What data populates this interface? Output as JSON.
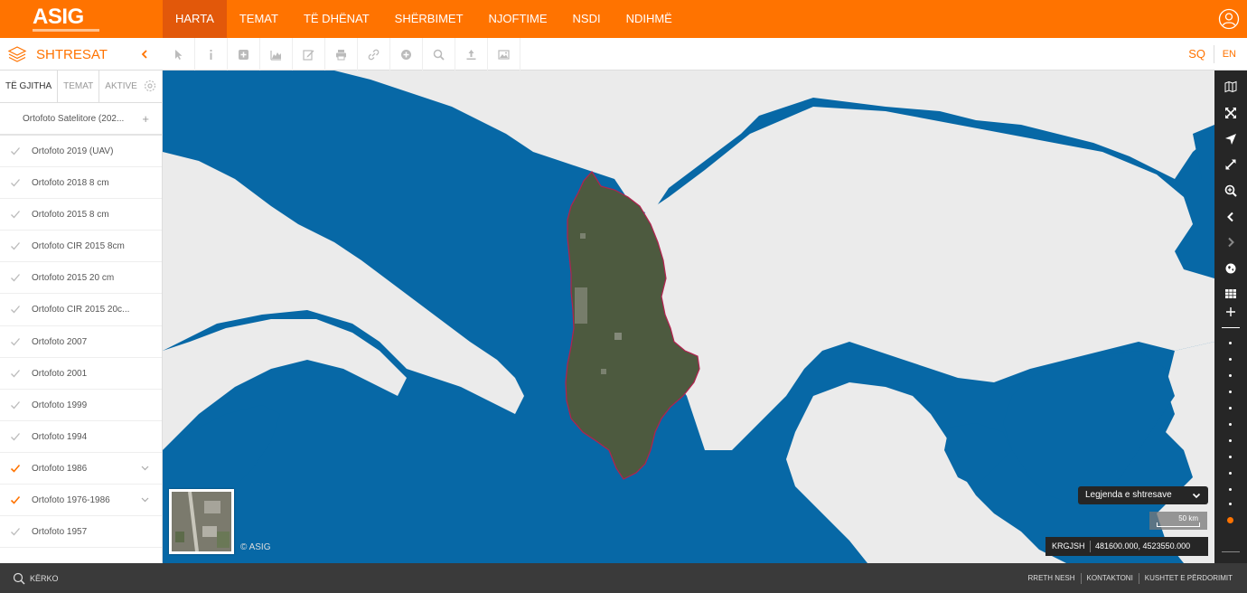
{
  "header": {
    "logo_text": "ASIG",
    "nav": [
      {
        "label": "HARTA",
        "active": true
      },
      {
        "label": "TEMAT",
        "active": false
      },
      {
        "label": "TË DHËNAT",
        "active": false
      },
      {
        "label": "SHËRBIMET",
        "active": false
      },
      {
        "label": "NJOFTIME",
        "active": false
      },
      {
        "label": "NSDI",
        "active": false
      },
      {
        "label": "NDIHMË",
        "active": false
      }
    ],
    "user_icon": "user-circle-icon"
  },
  "toolbar": {
    "layers_title": "SHTRESAT",
    "collapse_icon": "chevron-left-icon",
    "tools": [
      "pointer-icon",
      "info-icon",
      "add-box-icon",
      "chart-icon",
      "edit-icon",
      "print-icon",
      "link-icon",
      "plus-circle-icon",
      "search-icon",
      "upload-icon",
      "image-icon"
    ],
    "lang_sq": "SQ",
    "lang_en": "EN"
  },
  "sidebar": {
    "tabs": [
      "TË GJITHA",
      "TEMAT",
      "AKTIVE"
    ],
    "group": "Ortofoto Satelitore (202...",
    "layers": [
      {
        "label": "Ortofoto 2019 (UAV)",
        "checked": false,
        "expandable": false
      },
      {
        "label": "Ortofoto 2018 8 cm",
        "checked": false,
        "expandable": false
      },
      {
        "label": "Ortofoto 2015 8 cm",
        "checked": false,
        "expandable": false
      },
      {
        "label": "Ortofoto CIR 2015 8cm",
        "checked": false,
        "expandable": false
      },
      {
        "label": "Ortofoto 2015 20 cm",
        "checked": false,
        "expandable": false
      },
      {
        "label": "Ortofoto CIR 2015 20c...",
        "checked": false,
        "expandable": false
      },
      {
        "label": "Ortofoto 2007",
        "checked": false,
        "expandable": false
      },
      {
        "label": "Ortofoto 2001",
        "checked": false,
        "expandable": false
      },
      {
        "label": "Ortofoto 1999",
        "checked": false,
        "expandable": false
      },
      {
        "label": "Ortofoto 1994",
        "checked": false,
        "expandable": false
      },
      {
        "label": "Ortofoto 1986",
        "checked": true,
        "expandable": true
      },
      {
        "label": "Ortofoto 1976-1986",
        "checked": true,
        "expandable": true
      },
      {
        "label": "Ortofoto 1957",
        "checked": false,
        "expandable": false
      }
    ]
  },
  "map": {
    "copyright": "© ASIG",
    "legend_label": "Legjenda e shtresave",
    "scale_label": "50 km",
    "crs": "KRGJSH",
    "coordinates": "481600.000, 4523550.000",
    "colors": {
      "sea": "#0768a6",
      "land": "#ebebeb",
      "accent": "#ff7300"
    }
  },
  "footer": {
    "search_label": "KËRKO",
    "links": [
      "RRETH NESH",
      "KONTAKTONI",
      "KUSHTET E PËRDORIMIT"
    ]
  }
}
